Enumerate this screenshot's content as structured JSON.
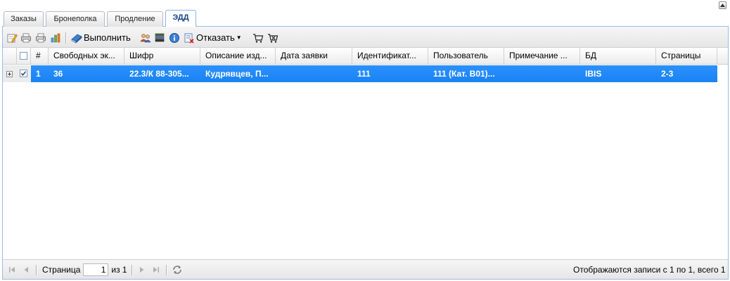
{
  "tabs": [
    {
      "label": "Заказы",
      "active": false
    },
    {
      "label": "Бронеполка",
      "active": false
    },
    {
      "label": "Продление",
      "active": false
    },
    {
      "label": "ЭДД",
      "active": true
    }
  ],
  "toolbar": {
    "icons": [
      "edit-icon",
      "print-icon",
      "print-alt-icon",
      "chart-icon",
      "book-icon",
      "users-icon",
      "stack-icon",
      "info-icon",
      "document-cancel-icon",
      "cart-icon",
      "cart-remove-icon"
    ],
    "execute_label": "Выполнить",
    "refuse_label": "Отказать"
  },
  "grid": {
    "columns": [
      "#",
      "Свободных эк...",
      "Шифр",
      "Описание изд...",
      "Дата заявки",
      "Идентификат...",
      "Пользователь",
      "Примечание ...",
      "БД",
      "Страницы"
    ],
    "rows": [
      {
        "checked": true,
        "selected": true,
        "cells": [
          "1",
          "36",
          "22.3/К 88-305...",
          "Кудрявцев, П...",
          "",
          "111",
          "111 (Кат. В01)...",
          "",
          "IBIS",
          "2-3"
        ]
      }
    ]
  },
  "pager": {
    "page_label": "Страница",
    "page_value": "1",
    "of_label": "из 1",
    "status": "Отображаются записи с 1 по 1, всего 1"
  },
  "colors": {
    "accent": "#1e88f5",
    "border": "#99bbe8",
    "active_tab_text": "#15428b"
  }
}
